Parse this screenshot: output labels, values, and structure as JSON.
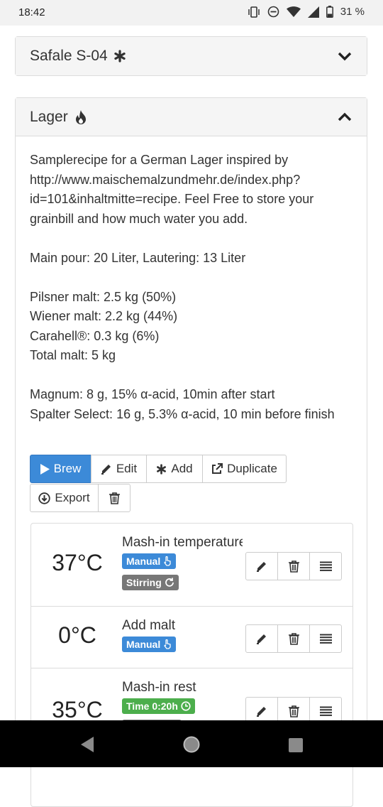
{
  "status": {
    "time": "18:42",
    "battery": "31 %"
  },
  "yeast": {
    "title": "Safale S-04",
    "icon": "asterisk-icon"
  },
  "recipe": {
    "title": "Lager",
    "icon": "fire-icon",
    "description": [
      "Samplerecipe for a German Lager inspired by http://www.maischemalzundmehr.de/index.php?id=101&inhaltmitte=recipe. Feel Free to store your grainbill and how much water you add.",
      "Main pour: 20 Liter, Lautering: 13 Liter",
      "Pilsner malt: 2.5 kg (50%)\nWiener malt: 2.2 kg (44%)\nCarahell®: 0.3 kg (6%)\nTotal malt: 5 kg",
      "Magnum: 8 g, 15% α-acid, 10min after start\nSpalter Select: 16 g, 5.3% α-acid, 10 min before finish"
    ],
    "buttons": {
      "brew": "Brew",
      "edit": "Edit",
      "add": "Add",
      "duplicate": "Duplicate",
      "export": "Export"
    }
  },
  "steps": [
    {
      "temp": "37°C",
      "name": "Mash-in temperature",
      "badges": [
        {
          "label": "Manual",
          "color": "#3c8ad8",
          "icon": "hand-pointer-icon"
        },
        {
          "label": "Stirring",
          "color": "#777777",
          "icon": "refresh-icon"
        }
      ]
    },
    {
      "temp": "0°C",
      "name": "Add malt",
      "badges": [
        {
          "label": "Manual",
          "color": "#3c8ad8",
          "icon": "hand-pointer-icon"
        }
      ]
    },
    {
      "temp": "35°C",
      "name": "Mash-in rest",
      "badges": [
        {
          "label": "Time 0:20h",
          "color": "#4cae4c",
          "icon": "clock-icon"
        }
      ]
    }
  ],
  "colors": {
    "primary": "#3c8ad8",
    "success": "#4cae4c",
    "muted": "#777777"
  }
}
